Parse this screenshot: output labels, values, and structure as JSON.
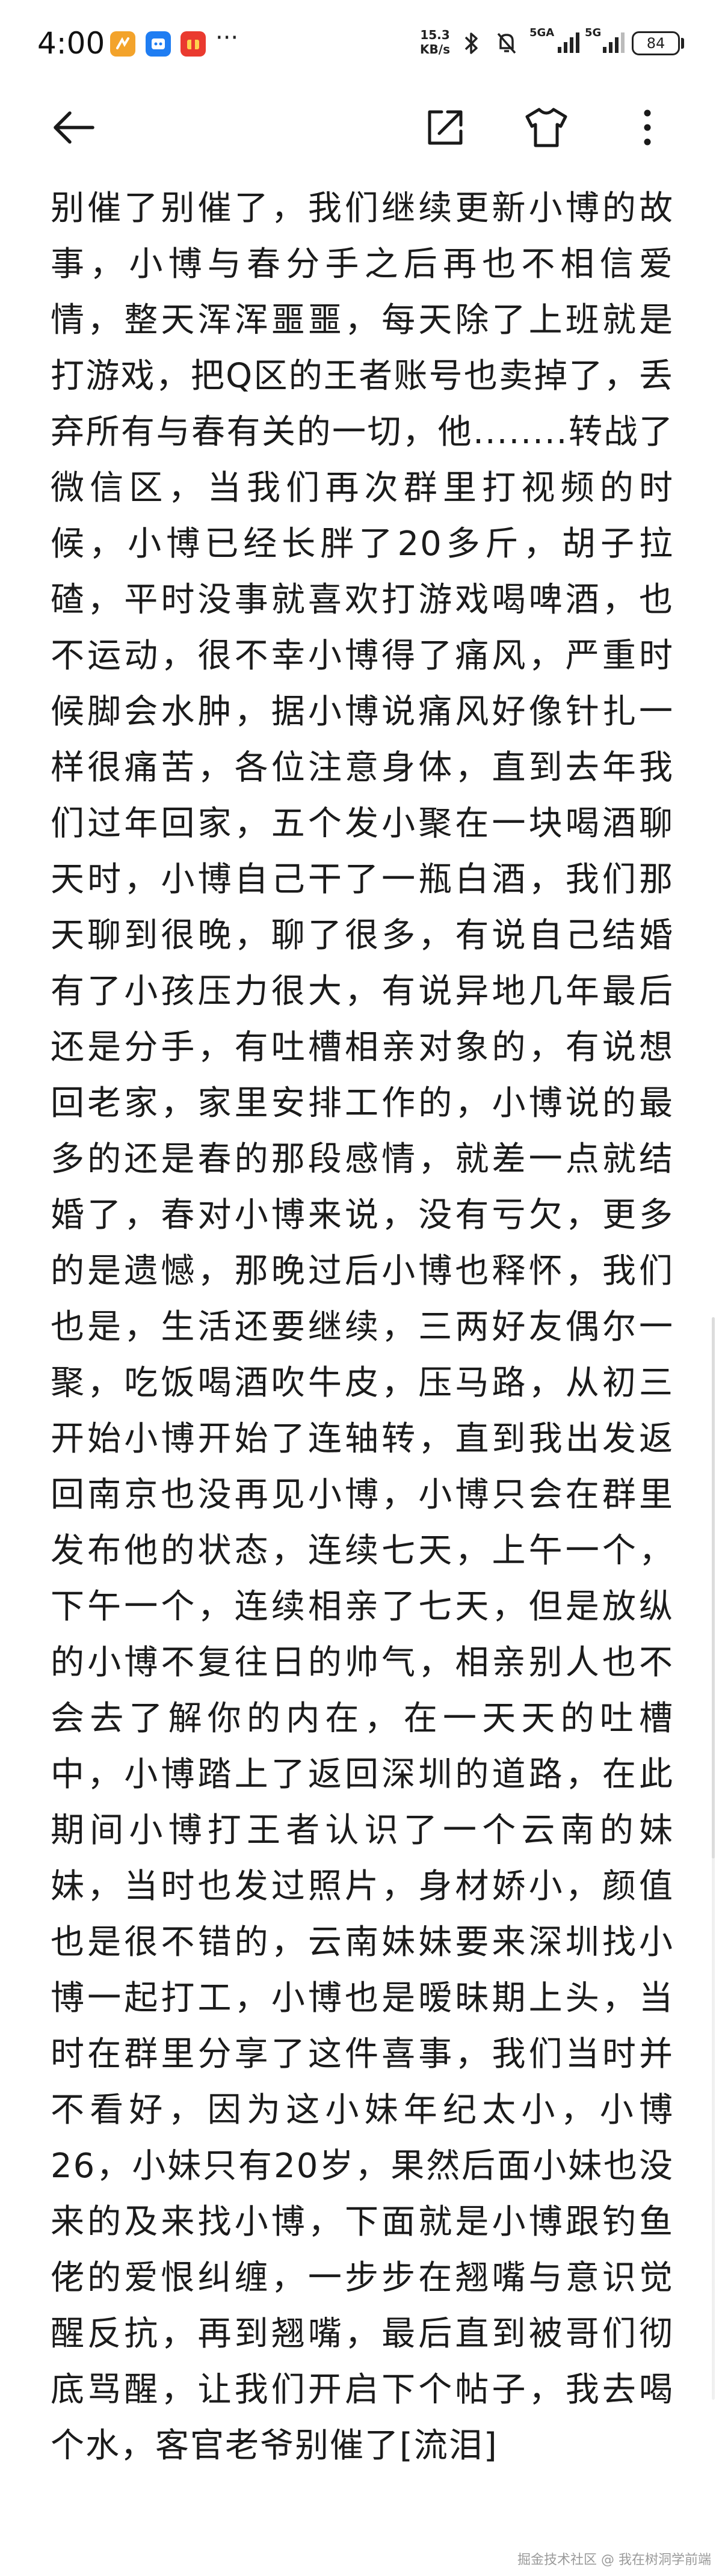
{
  "status_bar": {
    "time": "4:00",
    "more_indicator": "···",
    "speed_value": "15.3",
    "speed_unit": "KB/s",
    "sim1_label": "5GA",
    "sim2_label": "5G",
    "battery": "84",
    "icons": [
      "app-orange-icon",
      "app-blue-icon",
      "app-red-icon",
      "bluetooth-icon",
      "mute-bell-icon",
      "signal-icon",
      "signal-icon",
      "battery-icon"
    ]
  },
  "toolbar": {
    "icons": [
      "back-arrow-icon",
      "share-icon",
      "tshirt-icon",
      "more-vertical-icon"
    ]
  },
  "article": {
    "text": "别催了别催了，我们继续更新小博的故事，小博与春分手之后再也不相信爱情，整天浑浑噩噩，每天除了上班就是打游戏，把Q区的王者账号也卖掉了，丢弃所有与春有关的一切，他........转战了微信区，当我们再次群里打视频的时候，小博已经长胖了20多斤，胡子拉碴，平时没事就喜欢打游戏喝啤酒，也不运动，很不幸小博得了痛风，严重时候脚会水肿，据小博说痛风好像针扎一样很痛苦，各位注意身体，直到去年我们过年回家，五个发小聚在一块喝酒聊天时，小博自己干了一瓶白酒，我们那天聊到很晚，聊了很多，有说自己结婚有了小孩压力很大，有说异地几年最后还是分手，有吐槽相亲对象的，有说想回老家，家里安排工作的，小博说的最多的还是春的那段感情，就差一点就结婚了，春对小博来说，没有亏欠，更多的是遗憾，那晚过后小博也释怀，我们也是，生活还要继续，三两好友偶尔一聚，吃饭喝酒吹牛皮，压马路，从初三开始小博开始了连轴转，直到我出发返回南京也没再见小博，小博只会在群里发布他的状态，连续七天，上午一个，下午一个，连续相亲了七天，但是放纵的小博不复往日的帅气，相亲别人也不会去了解你的内在，在一天天的吐槽中，小博踏上了返回深圳的道路，在此期间小博打王者认识了一个云南的妹妹，当时也发过照片，身材娇小，颜值也是很不错的，云南妹妹要来深圳找小博一起打工，小博也是暧昧期上头，当时在群里分享了这件喜事，我们当时并不看好，因为这小妹年纪太小，小博26，小妹只有20岁，果然后面小妹也没来的及来找小博，下面就是小博跟钓鱼佬的爱恨纠缠，一步步在翘嘴与意识觉醒反抗，再到翘嘴，最后直到被哥们彻底骂醒，让我们开启下个帖子，我去喝个水，客官老爷别催了[流泪]"
  },
  "watermark": "掘金技术社区 @ 我在树洞学前端"
}
